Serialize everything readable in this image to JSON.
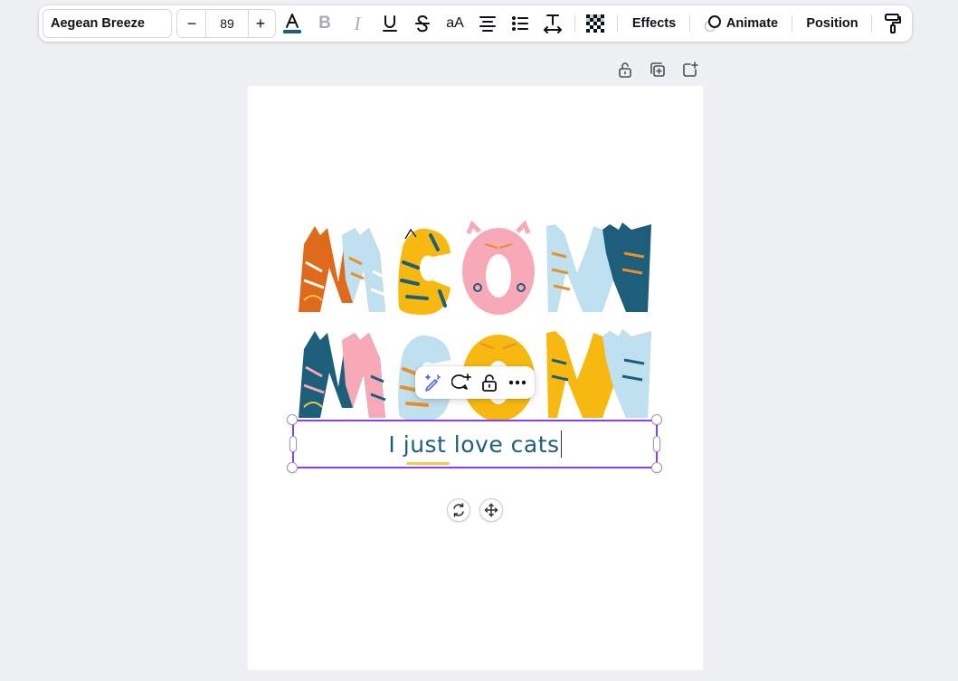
{
  "toolbar": {
    "font_name": "Aegean Breeze",
    "font_size": "89",
    "decrease_label": "−",
    "increase_label": "+",
    "case_label": "aA",
    "effects_label": "Effects",
    "animate_label": "Animate",
    "position_label": "Position",
    "text_color": "#1d5f7a",
    "icons": [
      "text-color-icon",
      "bold-icon",
      "italic-icon",
      "underline-icon",
      "strikethrough-icon",
      "letter-case-icon",
      "align-center-icon",
      "list-icon",
      "spacing-icon",
      "transparency-icon",
      "animate-icon",
      "paint-format-icon"
    ]
  },
  "page_controls": {
    "icons": [
      "lock-icon",
      "duplicate-page-icon",
      "add-page-icon"
    ]
  },
  "context_menu": {
    "icons": [
      "magic-edit-icon",
      "add-comment-icon",
      "lock-icon",
      "more-icon"
    ]
  },
  "text_box": {
    "content": "I just love cats"
  },
  "design": {
    "illustration": "MEOW MEOW cat letters illustration",
    "accent": "#8b3dff"
  },
  "bottom_controls": {
    "icons": [
      "rotate-icon",
      "move-icon"
    ]
  }
}
